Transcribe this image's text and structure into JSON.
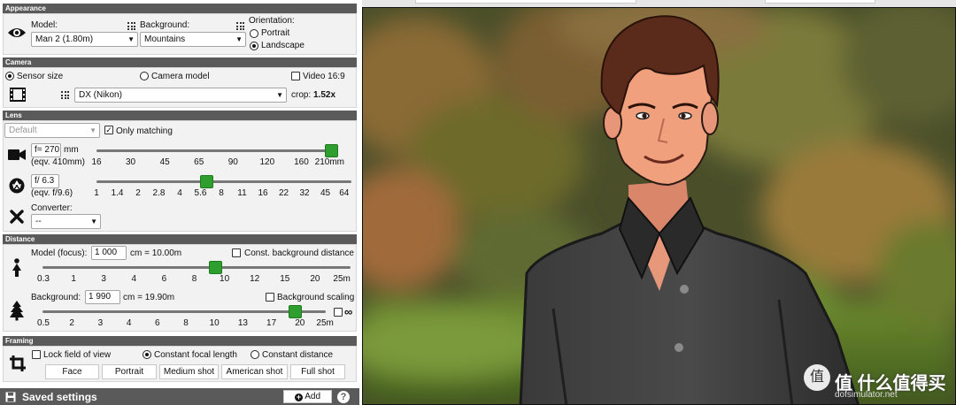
{
  "appearance": {
    "header": "Appearance",
    "model_label": "Model:",
    "model_value": "Man 2 (1.80m)",
    "background_label": "Background:",
    "background_value": "Mountains",
    "orientation_label": "Orientation:",
    "portrait_label": "Portrait",
    "landscape_label": "Landscape",
    "orientation_selected": "Landscape"
  },
  "camera": {
    "header": "Camera",
    "sensor_size_label": "Sensor size",
    "camera_model_label": "Camera model",
    "video_label": "Video 16:9",
    "sensor_value": "DX (Nikon)",
    "crop_label": "crop:",
    "crop_value": "1.52x"
  },
  "lens": {
    "header": "Lens",
    "lens_select": "Default",
    "only_matching_label": "Only matching",
    "focal_input": "f= 270",
    "focal_unit": "mm",
    "focal_eqv": "(eqv. 410mm)",
    "focal_ticks": [
      "16",
      "30",
      "45",
      "65",
      "90",
      "120",
      "160",
      "210mm"
    ],
    "focal_position": 0.98,
    "aperture_input": "f/ 6.3",
    "aperture_eqv": "(eqv. f/9.6)",
    "aperture_ticks": [
      "1",
      "1.4",
      "2",
      "2.8",
      "4",
      "5.6",
      "8",
      "11",
      "16",
      "22",
      "32",
      "45",
      "64"
    ],
    "aperture_position": 0.43,
    "converter_label": "Converter:",
    "converter_value": "--"
  },
  "distance": {
    "header": "Distance",
    "model_focus_label": "Model (focus):",
    "model_focus_value": "1 000",
    "model_focus_result": "cm = 10.00m",
    "const_bg_label": "Const. background distance",
    "model_ticks": [
      "0.3",
      "1",
      "3",
      "4",
      "6",
      "8",
      "10",
      "12",
      "15",
      "20",
      "25m"
    ],
    "model_position": 0.56,
    "background_label": "Background:",
    "background_value": "1 990",
    "background_result": "cm = 19.90m",
    "bg_scaling_label": "Background scaling",
    "bg_ticks": [
      "0.5",
      "2",
      "3",
      "4",
      "6",
      "8",
      "10",
      "13",
      "17",
      "20",
      "25m"
    ],
    "bg_position": 0.89,
    "infinity_label": "∞"
  },
  "framing": {
    "header": "Framing",
    "lock_fov_label": "Lock field of view",
    "const_focal_label": "Constant focal length",
    "const_distance_label": "Constant distance",
    "buttons": [
      "Face",
      "Portrait",
      "Medium shot",
      "American shot",
      "Full shot"
    ]
  },
  "saved": {
    "title": "Saved settings",
    "add_label": "Add",
    "help_label": "?"
  },
  "watermark": {
    "text": "值 什么值得买",
    "site": "dofsimulator.net"
  },
  "colors": {
    "header_bg": "#5a5a5a",
    "slider_thumb": "#2e9e2e",
    "section_bg": "#f2f2f2"
  }
}
